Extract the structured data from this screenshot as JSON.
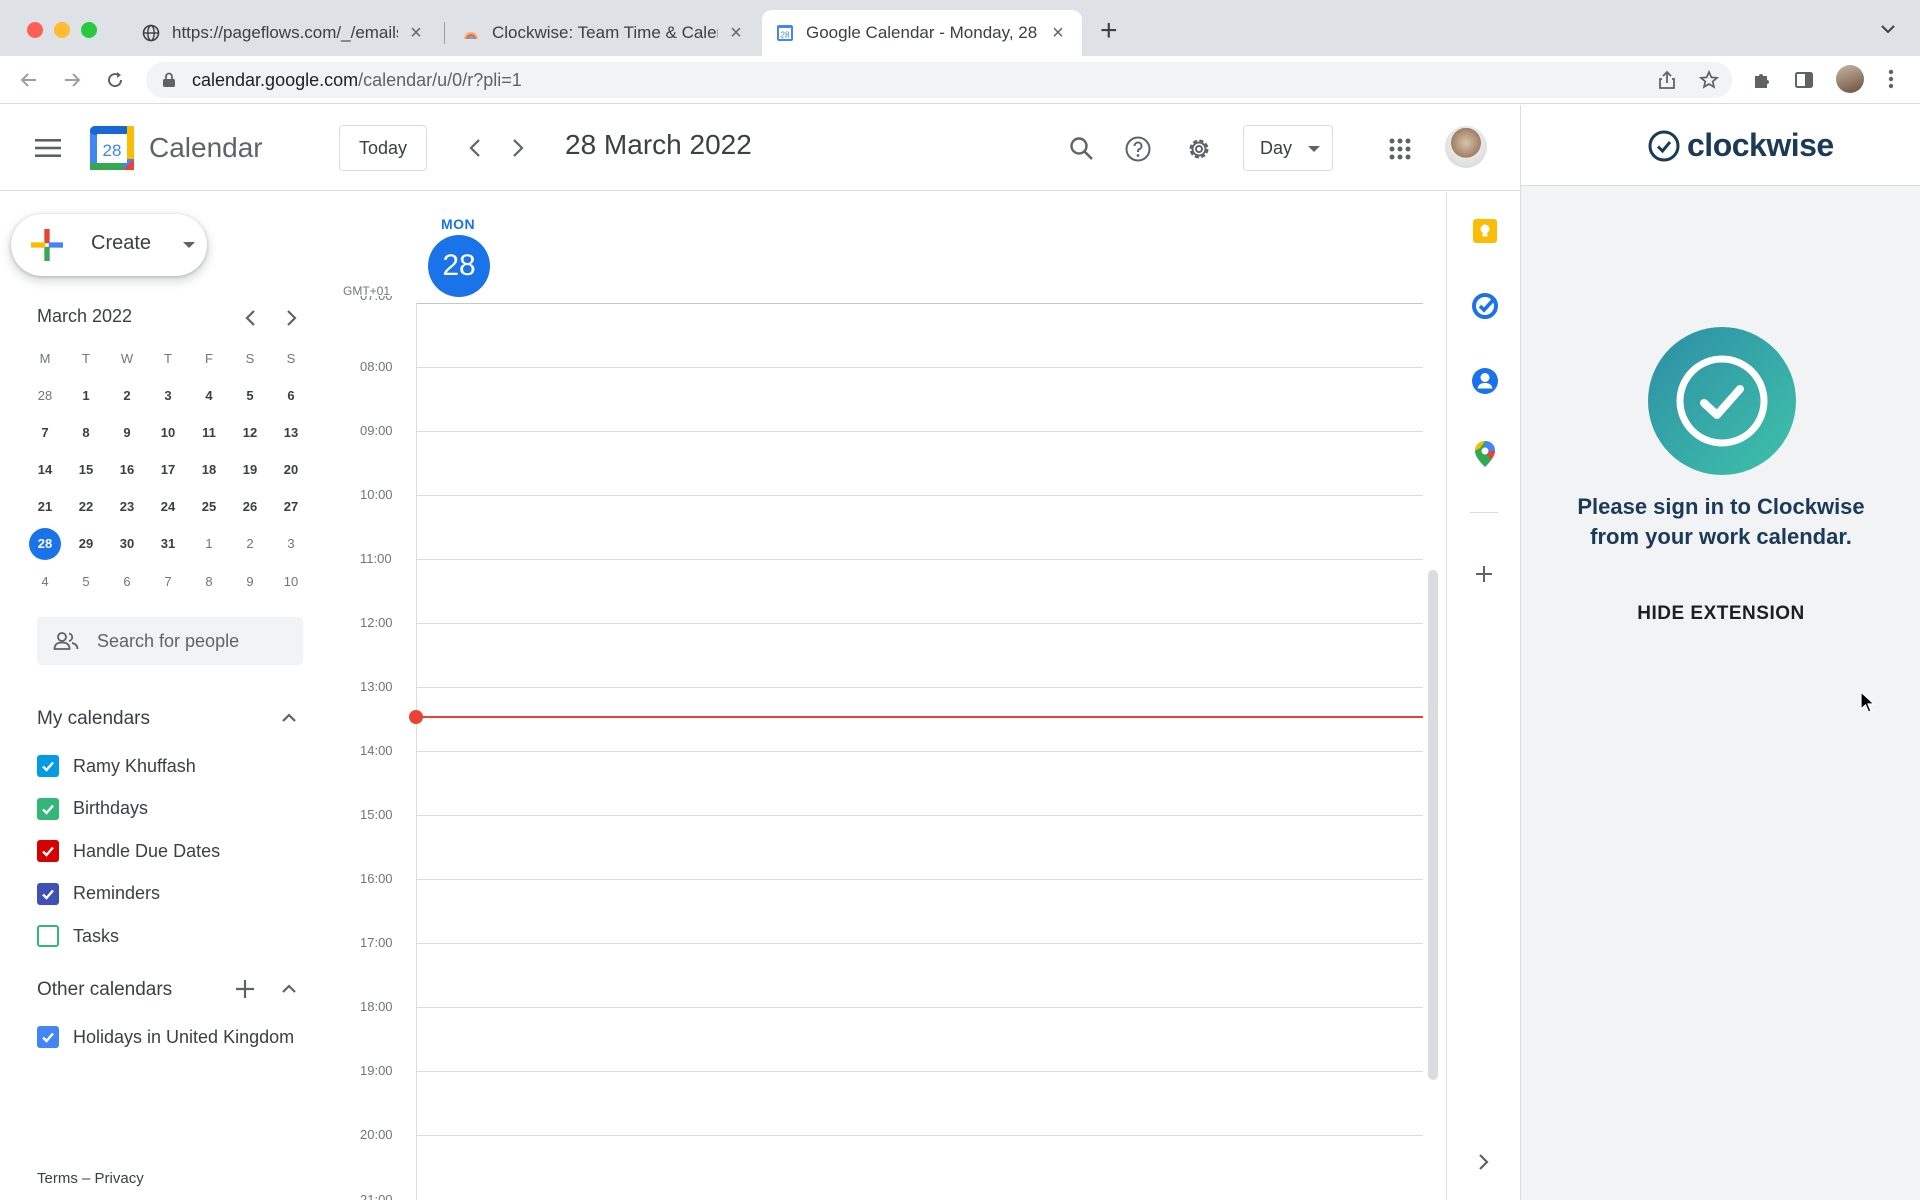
{
  "browser": {
    "tabs": [
      {
        "title": "https://pageflows.com/_/emails",
        "active": false
      },
      {
        "title": "Clockwise: Team Time & Calen",
        "active": false
      },
      {
        "title": "Google Calendar - Monday, 28",
        "active": true
      }
    ],
    "new_tab_label": "+",
    "url_host": "calendar.google.com",
    "url_path": "/calendar/u/0/r?pli=1"
  },
  "header": {
    "app_name": "Calendar",
    "logo_day": "28",
    "today_label": "Today",
    "date_title": "28 March 2022",
    "view_label": "Day"
  },
  "sidebar": {
    "create_label": "Create",
    "mini_calendar": {
      "title": "March 2022",
      "weekdays": [
        "M",
        "T",
        "W",
        "T",
        "F",
        "S",
        "S"
      ],
      "weeks": [
        [
          "28",
          "1",
          "2",
          "3",
          "4",
          "5",
          "6"
        ],
        [
          "7",
          "8",
          "9",
          "10",
          "11",
          "12",
          "13"
        ],
        [
          "14",
          "15",
          "16",
          "17",
          "18",
          "19",
          "20"
        ],
        [
          "21",
          "22",
          "23",
          "24",
          "25",
          "26",
          "27"
        ],
        [
          "28",
          "29",
          "30",
          "31",
          "1",
          "2",
          "3"
        ],
        [
          "4",
          "5",
          "6",
          "7",
          "8",
          "9",
          "10"
        ]
      ]
    },
    "people_search_placeholder": "Search for people",
    "my_calendars": {
      "title": "My calendars",
      "items": [
        {
          "label": "Ramy Khuffash",
          "color": "#039be5",
          "checked": true
        },
        {
          "label": "Birthdays",
          "color": "#33b679",
          "checked": true
        },
        {
          "label": "Handle Due Dates",
          "color": "#d50000",
          "checked": true
        },
        {
          "label": "Reminders",
          "color": "#3f51b5",
          "checked": true
        },
        {
          "label": "Tasks",
          "color": "#33b679",
          "checked": false
        }
      ]
    },
    "other_calendars": {
      "title": "Other calendars",
      "items": [
        {
          "label": "Holidays in United Kingdom",
          "color": "#4285f4",
          "checked": true
        }
      ]
    },
    "footer": {
      "terms": "Terms",
      "separator": "–",
      "privacy": "Privacy"
    }
  },
  "day_view": {
    "dow": "MON",
    "date": "28",
    "timezone": "GMT+01",
    "hours": [
      "08:00",
      "09:00",
      "10:00",
      "11:00",
      "12:00",
      "13:00",
      "14:00",
      "15:00",
      "16:00",
      "17:00",
      "18:00",
      "19:00",
      "20:00"
    ]
  },
  "clockwise": {
    "brand": "clockwise",
    "message_line1": "Please sign in to Clockwise",
    "message_line2": "from your work calendar.",
    "hide_label": "HIDE EXTENSION"
  },
  "colors": {
    "accent": "#1a73e8",
    "now_line": "#ea4335",
    "clockwise_navy": "#1b3a57"
  }
}
